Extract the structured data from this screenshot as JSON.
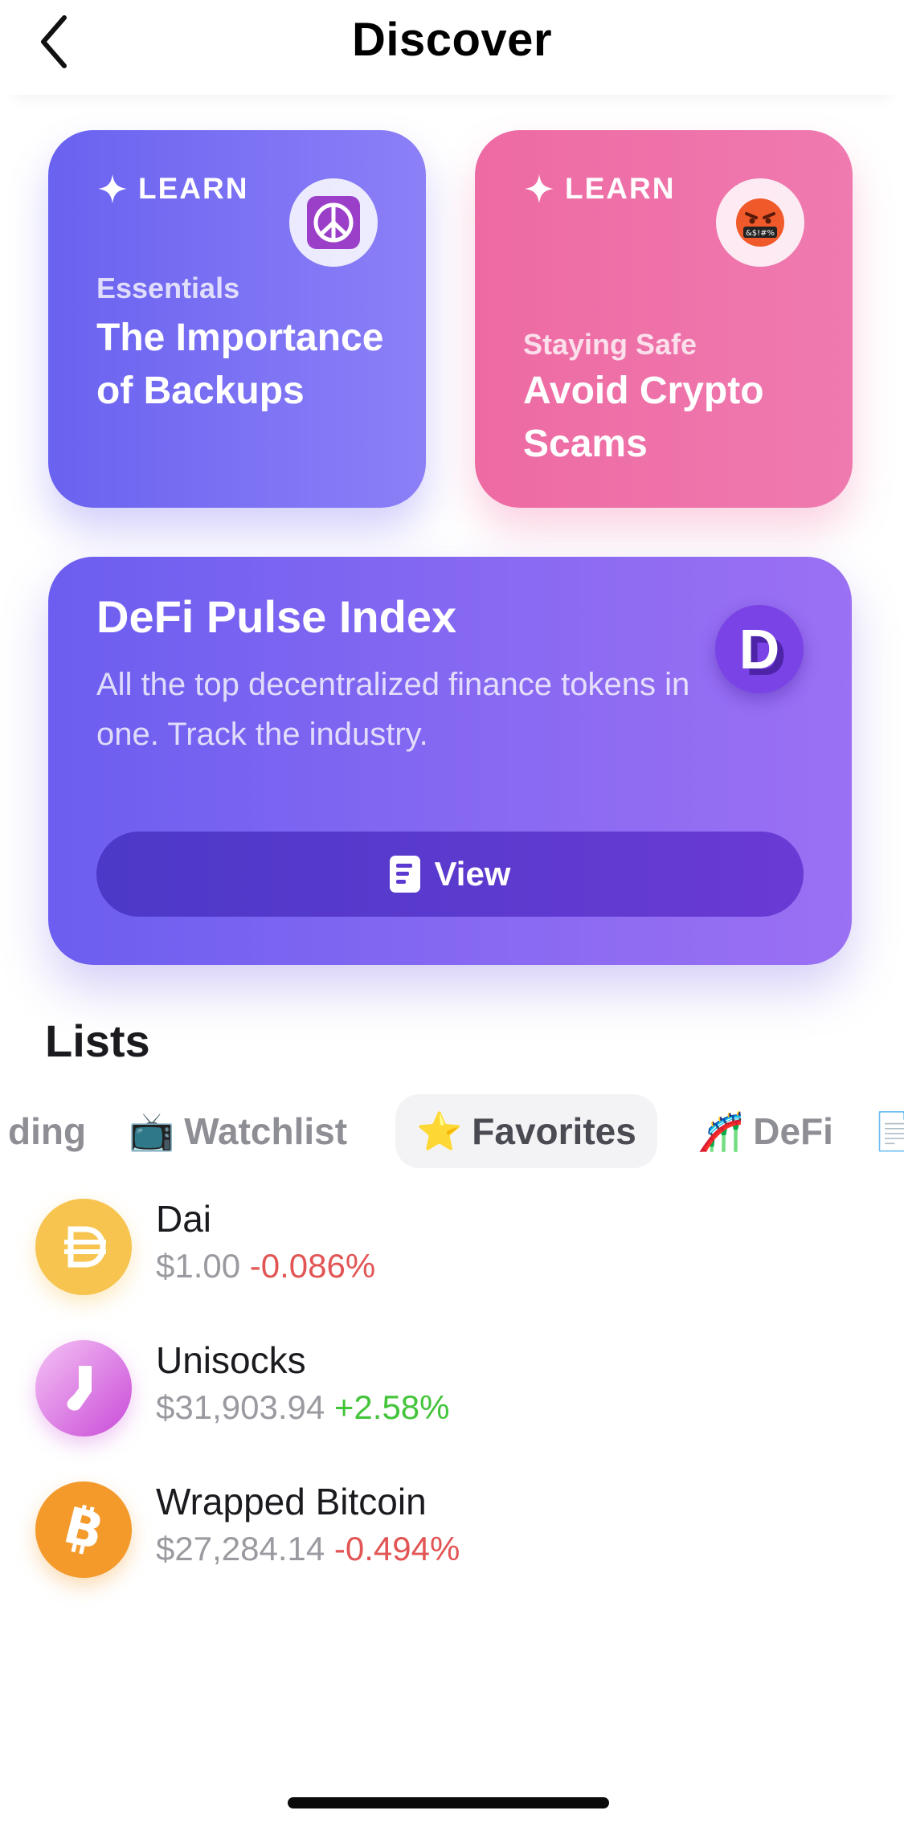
{
  "header": {
    "title": "Discover",
    "back_icon": "chevron-left-icon"
  },
  "learn_cards": [
    {
      "label": "LEARN",
      "category": "Essentials",
      "title": "The Importance of Backups",
      "emoji": "☮️",
      "color": "#6a62f0"
    },
    {
      "label": "LEARN",
      "category": "Staying Safe",
      "title": "Avoid Crypto Scams",
      "emoji": "🤬",
      "color": "#ee6aa2"
    }
  ],
  "defi": {
    "title": "DeFi Pulse Index",
    "description": "All the top decentralized finance tokens in one. Track the industry.",
    "logo_letter": "D",
    "button_label": "View",
    "button_icon": "document-icon"
  },
  "lists": {
    "title": "Lists",
    "chips": [
      {
        "emoji": "",
        "label": "ding"
      },
      {
        "emoji": "📺",
        "label": "Watchlist"
      },
      {
        "emoji": "⭐",
        "label": "Favorites",
        "active": true
      },
      {
        "emoji": "🎢",
        "label": "DeFi"
      },
      {
        "emoji": "📄",
        "label": ""
      }
    ],
    "coins": [
      {
        "name": "Dai",
        "price": "$1.00",
        "change": "-0.086%",
        "direction": "negative",
        "icon_color": "#f6c44f"
      },
      {
        "name": "Unisocks",
        "price": "$31,903.94",
        "change": "+2.58%",
        "direction": "positive",
        "icon_color": "#d46ae0"
      },
      {
        "name": "Wrapped Bitcoin",
        "price": "$27,284.14",
        "change": "-0.494%",
        "direction": "negative",
        "icon_color": "#f39a2b"
      }
    ]
  }
}
